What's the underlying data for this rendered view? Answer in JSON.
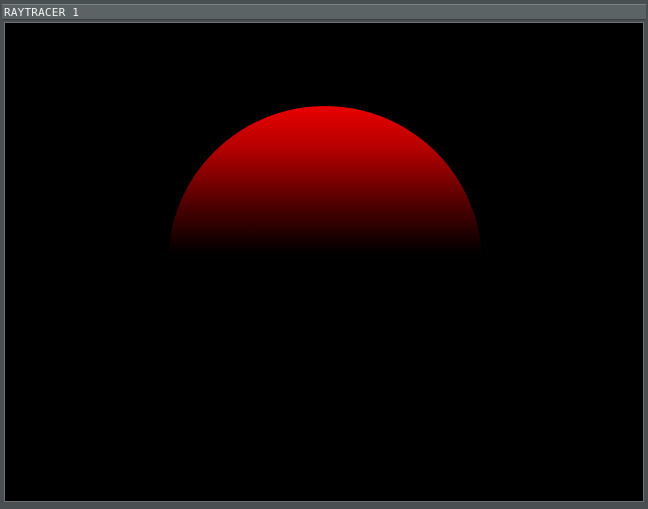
{
  "window": {
    "title": "RAYTRACER 1"
  },
  "scene": {
    "background_color": "#000000",
    "sphere_color": "#e00000",
    "object": "red-sphere"
  }
}
